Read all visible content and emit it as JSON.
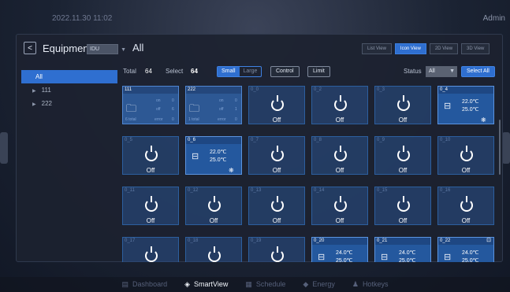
{
  "topbar": {
    "datetime": "2022.11.30   11:02",
    "user": "Admin"
  },
  "header": {
    "back_icon": "chevron-left-icon",
    "title": "Equipment",
    "type_select": "IDU",
    "group": "All"
  },
  "view_tabs": [
    {
      "label": "List View",
      "active": false
    },
    {
      "label": "Icon View",
      "active": true
    },
    {
      "label": "2D View",
      "active": false
    },
    {
      "label": "3D View",
      "active": false
    }
  ],
  "tree": [
    {
      "label": "All",
      "selected": true
    },
    {
      "label": "111",
      "selected": false
    },
    {
      "label": "222",
      "selected": false
    }
  ],
  "toolbar": {
    "total_label": "Total",
    "total_value": "64",
    "select_label": "Select",
    "select_value": "64",
    "size_small": "Small",
    "size_large": "Large",
    "control": "Control",
    "limit": "Limit",
    "status_label": "Status",
    "status_value": "All",
    "select_all": "Select All"
  },
  "group_cards": [
    {
      "name": "111",
      "on_label": "on",
      "on_value": "0",
      "off_label": "off",
      "off_value": "6",
      "total_label": "6 total",
      "error_label": "error",
      "error_value": "0"
    },
    {
      "name": "222",
      "on_label": "on",
      "on_value": "0",
      "off_label": "off",
      "off_value": "1",
      "total_label": "1 total",
      "error_label": "error",
      "error_value": "0"
    }
  ],
  "unit_cards": [
    {
      "name": "0_0",
      "state": "Off"
    },
    {
      "name": "0_2",
      "state": "Off"
    },
    {
      "name": "0_3",
      "state": "Off"
    },
    {
      "name": "0_4",
      "state": "On",
      "setpoint": "22.0℃",
      "room": "25.0℃"
    },
    {
      "name": "0_5",
      "state": "Off"
    },
    {
      "name": "0_6",
      "state": "On",
      "setpoint": "22.0℃",
      "room": "25.0℃"
    },
    {
      "name": "0_7",
      "state": "Off"
    },
    {
      "name": "0_8",
      "state": "Off"
    },
    {
      "name": "0_9",
      "state": "Off"
    },
    {
      "name": "0_10",
      "state": "Off"
    },
    {
      "name": "0_11",
      "state": "Off"
    },
    {
      "name": "0_12",
      "state": "Off"
    },
    {
      "name": "0_13",
      "state": "Off"
    },
    {
      "name": "0_14",
      "state": "Off"
    },
    {
      "name": "0_15",
      "state": "Off"
    },
    {
      "name": "0_16",
      "state": "Off"
    },
    {
      "name": "0_17",
      "state": "Off"
    },
    {
      "name": "0_18",
      "state": "Off"
    },
    {
      "name": "0_19",
      "state": "Off"
    },
    {
      "name": "0_20",
      "state": "On",
      "setpoint": "24.0℃",
      "room": "25.0℃"
    },
    {
      "name": "0_21",
      "state": "On",
      "setpoint": "24.0℃",
      "room": "25.0℃"
    },
    {
      "name": "0_22",
      "state": "On",
      "setpoint": "24.0℃",
      "room": "25.0℃"
    }
  ],
  "bottom_nav": [
    {
      "label": "Dashboard",
      "icon": "dashboard-icon",
      "active": false
    },
    {
      "label": "SmartView",
      "icon": "layers-icon",
      "active": true
    },
    {
      "label": "Schedule",
      "icon": "calendar-icon",
      "active": false
    },
    {
      "label": "Energy",
      "icon": "energy-icon",
      "active": false
    },
    {
      "label": "Hotkeys",
      "icon": "hotkeys-icon",
      "active": false
    }
  ],
  "colors": {
    "accent": "#2f6fd0",
    "card": "#24589e",
    "background": "#1b2333"
  }
}
